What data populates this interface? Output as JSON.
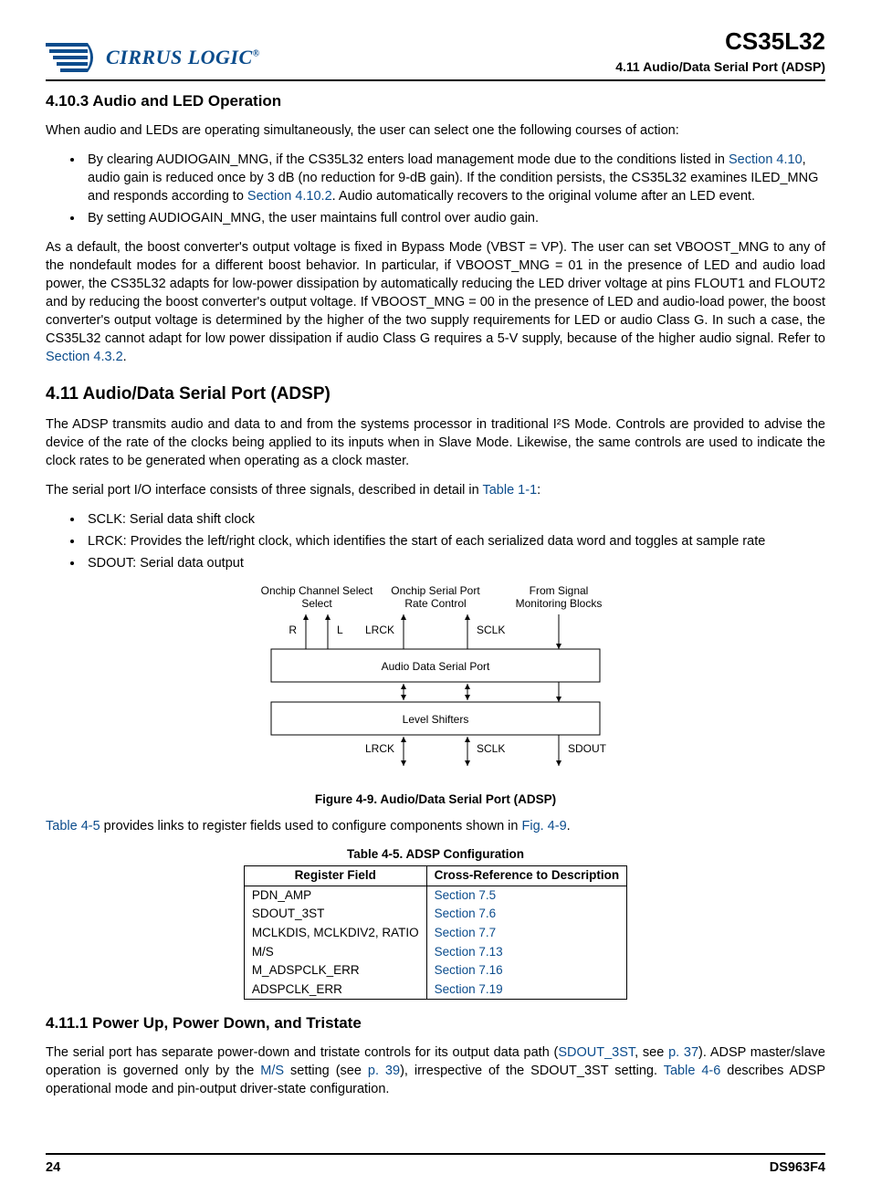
{
  "header": {
    "logo_text": "CIRRUS LOGIC",
    "part_number": "CS35L32",
    "section_label": "4.11 Audio/Data Serial Port (ADSP)"
  },
  "s4_10_3": {
    "heading": "4.10.3   Audio and LED Operation",
    "intro": "When audio and LEDs are operating simultaneously, the user can select one the following courses of action:",
    "bullet1_a": "By clearing AUDIOGAIN_MNG, if the CS35L32 enters load management mode due to the conditions listed in ",
    "bullet1_link1": "Section 4.10",
    "bullet1_b": ", audio gain is reduced once by 3 dB (no reduction for 9-dB gain). If the condition persists, the CS35L32 examines ILED_MNG and responds according to ",
    "bullet1_link2": "Section 4.10.2",
    "bullet1_c": ". Audio automatically recovers to the original volume after an LED event.",
    "bullet2": "By setting AUDIOGAIN_MNG, the user maintains full control over audio gain.",
    "para2_a": "As a default, the boost converter's output voltage is fixed in Bypass Mode (VBST = VP). The user can set VBOOST_MNG to any of the nondefault modes for a different boost behavior. In particular, if VBOOST_MNG = 01 in the presence of LED and audio load power, the CS35L32 adapts for low-power dissipation by automatically reducing the LED driver voltage at pins FLOUT1 and FLOUT2 and by reducing the boost converter's output voltage. If VBOOST_MNG = 00 in the presence of LED and audio-load power, the boost converter's output voltage is determined by the higher of the two supply requirements for LED or audio Class G. In such a case, the CS35L32 cannot adapt for low power dissipation if audio Class G requires a 5-V supply, because of the higher audio signal. Refer to ",
    "para2_link": "Section 4.3.2",
    "para2_b": "."
  },
  "s4_11": {
    "heading": "4.11 Audio/Data Serial Port (ADSP)",
    "para1": "The ADSP transmits audio and data to and from the systems processor in traditional I²S Mode. Controls are provided to advise the device of the rate of the clocks being applied to its inputs when in Slave Mode. Likewise, the same controls are used to indicate the clock rates to be generated when operating as a clock master.",
    "para2_a": "The serial port I/O interface consists of three signals, described in detail in ",
    "para2_link": "Table 1-1",
    "para2_b": ":",
    "signals": [
      "SCLK: Serial data shift clock",
      "LRCK: Provides the left/right clock, which identifies the start of each serialized data word and toggles at sample rate",
      "SDOUT: Serial data output"
    ],
    "diagram": {
      "top_labels": [
        "Onchip Channel Select",
        "Onchip Serial Port Rate Control",
        "From Signal Monitoring Blocks"
      ],
      "top_signals": [
        "R",
        "L",
        "LRCK",
        "SCLK"
      ],
      "box1": "Audio Data Serial Port",
      "box2": "Level Shifters",
      "bottom_signals": [
        "LRCK",
        "SCLK",
        "SDOUT"
      ]
    },
    "fig_caption": "Figure 4-9. Audio/Data Serial Port (ADSP)",
    "para3_link1": "Table 4-5",
    "para3_a": " provides links to register fields used to configure components shown in ",
    "para3_link2": "Fig. 4-9",
    "para3_b": ".",
    "table_caption": "Table 4-5.  ADSP Configuration",
    "table_headers": [
      "Register Field",
      "Cross-Reference to Description"
    ],
    "table_rows": [
      {
        "field": "PDN_AMP",
        "ref": "Section 7.5"
      },
      {
        "field": "SDOUT_3ST",
        "ref": "Section 7.6"
      },
      {
        "field": "MCLKDIS, MCLKDIV2, RATIO",
        "ref": "Section 7.7"
      },
      {
        "field": "M/S",
        "ref": "Section 7.13"
      },
      {
        "field": "M_ADSPCLK_ERR",
        "ref": "Section 7.16"
      },
      {
        "field": "ADSPCLK_ERR",
        "ref": "Section 7.19"
      }
    ]
  },
  "s4_11_1": {
    "heading": "4.11.1   Power Up, Power Down, and Tristate",
    "para_a": "The serial port has separate power-down and tristate controls for its output data path (",
    "link1": "SDOUT_3ST",
    "para_b": ", see ",
    "link2": "p. 37",
    "para_c": "). ADSP master/slave operation is governed only by the ",
    "link3": "M/S",
    "para_d": " setting (see ",
    "link4": "p. 39",
    "para_e": "), irrespective of the SDOUT_3ST setting. ",
    "link5": "Table 4-6",
    "para_f": " describes ADSP operational mode and pin-output driver-state configuration."
  },
  "footer": {
    "page": "24",
    "doc": "DS963F4"
  }
}
